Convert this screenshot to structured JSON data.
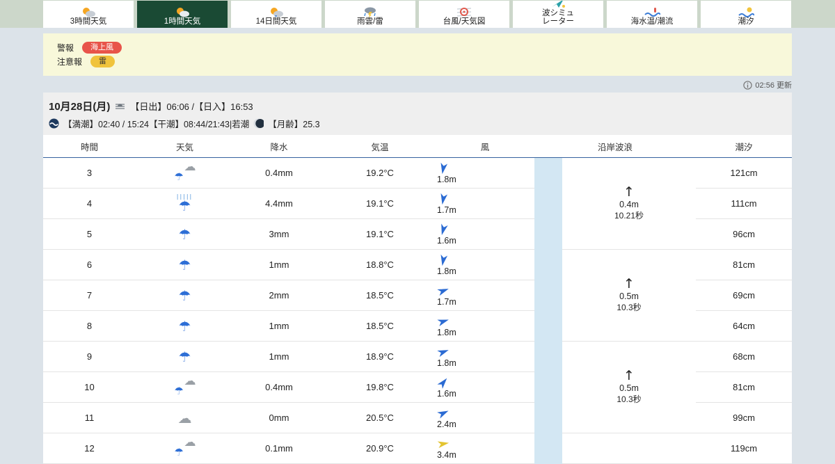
{
  "tabs": [
    {
      "label": "3時間天気",
      "icon": "sun-cloud-icon",
      "selected": false
    },
    {
      "label": "1時間天気",
      "icon": "sun-cloud-icon",
      "selected": true
    },
    {
      "label": "14日間天気",
      "icon": "sun-cloud-icon",
      "selected": false
    },
    {
      "label": "雨雲/雷",
      "icon": "rain-lightning-icon",
      "selected": false
    },
    {
      "label": "台風/天気図",
      "icon": "typhoon-map-icon",
      "selected": false
    },
    {
      "label": "波シミュ\nレーター",
      "icon": "wave-arrow-icon",
      "selected": false
    },
    {
      "label": "海水温/潮流",
      "icon": "sea-temp-icon",
      "selected": false
    },
    {
      "label": "潮汐",
      "icon": "tide-moon-icon",
      "selected": false
    }
  ],
  "alerts": {
    "warning_label": "警報",
    "warning_badge": "海上風",
    "advisory_label": "注意報",
    "advisory_badge": "雷",
    "warning_color": "#e8544a",
    "advisory_color": "#f0c33c"
  },
  "updated": "02:56 更新",
  "day": {
    "date": "10月28日(月)",
    "sun_times": "【日出】06:06 /【日入】16:53",
    "tide_info": "【満潮】02:40 / 15:24【干潮】08:44/21:43|若潮",
    "moon_info": "【月齢】25.3"
  },
  "table": {
    "headers": [
      "時間",
      "天気",
      "降水",
      "気温",
      "風",
      "沿岸波浪",
      "潮汐"
    ],
    "rows": [
      {
        "hour": "3",
        "icon": "cloud-rain",
        "precip": "0.4mm",
        "temp": "19.2°C",
        "wind": {
          "speed": "1.8m",
          "deg": 190,
          "color": "#2b6bd3"
        },
        "tide": "121cm"
      },
      {
        "hour": "4",
        "icon": "heavy-rain",
        "precip": "4.4mm",
        "temp": "19.1°C",
        "wind": {
          "speed": "1.7m",
          "deg": 190,
          "color": "#2b6bd3"
        },
        "tide": "111cm"
      },
      {
        "hour": "5",
        "icon": "rain",
        "precip": "3mm",
        "temp": "19.1°C",
        "wind": {
          "speed": "1.6m",
          "deg": 195,
          "color": "#2b6bd3"
        },
        "tide": "96cm"
      },
      {
        "hour": "6",
        "icon": "rain",
        "precip": "1mm",
        "temp": "18.8°C",
        "wind": {
          "speed": "1.8m",
          "deg": 190,
          "color": "#2b6bd3"
        },
        "tide": "81cm"
      },
      {
        "hour": "7",
        "icon": "rain",
        "precip": "2mm",
        "temp": "18.5°C",
        "wind": {
          "speed": "1.7m",
          "deg": 70,
          "color": "#2b6bd3"
        },
        "tide": "69cm"
      },
      {
        "hour": "8",
        "icon": "rain",
        "precip": "1mm",
        "temp": "18.5°C",
        "wind": {
          "speed": "1.8m",
          "deg": 72,
          "color": "#2b6bd3"
        },
        "tide": "64cm"
      },
      {
        "hour": "9",
        "icon": "rain",
        "precip": "1mm",
        "temp": "18.9°C",
        "wind": {
          "speed": "1.8m",
          "deg": 70,
          "color": "#2b6bd3"
        },
        "tide": "68cm"
      },
      {
        "hour": "10",
        "icon": "cloud-rain",
        "precip": "0.4mm",
        "temp": "19.8°C",
        "wind": {
          "speed": "1.6m",
          "deg": 40,
          "color": "#2b6bd3"
        },
        "tide": "81cm"
      },
      {
        "hour": "11",
        "icon": "cloud",
        "precip": "0mm",
        "temp": "20.5°C",
        "wind": {
          "speed": "2.4m",
          "deg": 65,
          "color": "#2b6bd3"
        },
        "tide": "99cm"
      },
      {
        "hour": "12",
        "icon": "cloud-rain",
        "precip": "0.1mm",
        "temp": "20.9°C",
        "wind": {
          "speed": "3.4m",
          "deg": 80,
          "color": "#e3c430"
        },
        "tide": "119cm"
      }
    ],
    "wave_groups": [
      {
        "height": "0.4m",
        "period": "10.21秒",
        "span": 3
      },
      {
        "height": "0.5m",
        "period": "10.3秒",
        "span": 3
      },
      {
        "height": "0.5m",
        "period": "10.3秒",
        "span": 3
      },
      {
        "height": "",
        "period": "",
        "span": 1
      }
    ]
  }
}
